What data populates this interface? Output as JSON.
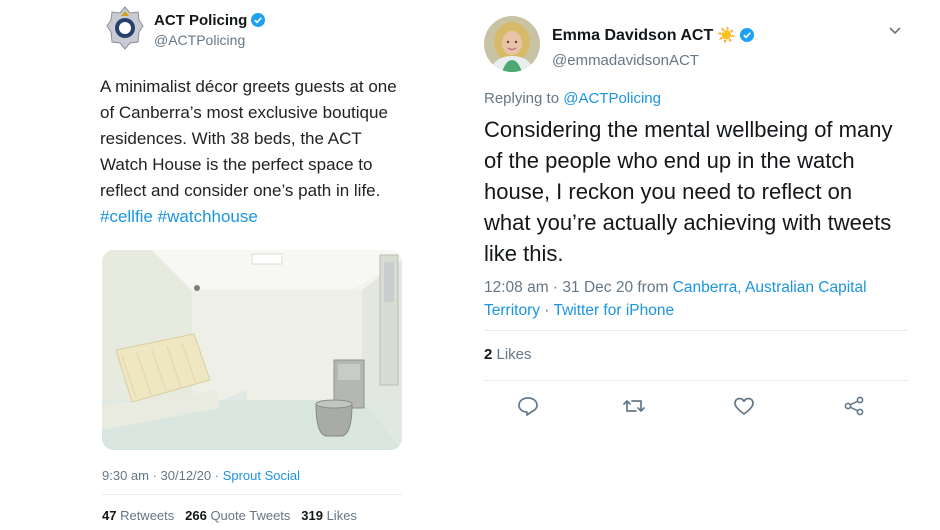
{
  "left_tweet": {
    "author_name": "ACT Policing",
    "author_handle": "@ACTPolicing",
    "text": "A minimalist décor greets guests at one of Canberra’s most exclusive boutique residences. With 38 beds, the ACT Watch House is the perfect space to reflect and consider one’s path in life.",
    "hashtags": [
      "#cellfie",
      "#watchhouse"
    ],
    "time": "9:30 am · 30/12/20 · ",
    "source": "Sprout Social",
    "stats": {
      "retweets_count": "47",
      "retweets_label": " Retweets",
      "quote_count": "266",
      "quote_label": " Quote Tweets",
      "likes_count": "319",
      "likes_label": " Likes"
    }
  },
  "right_tweet": {
    "author_name": "Emma Davidson ACT",
    "author_emoji": "☀️",
    "author_handle": "@emmadavidsonACT",
    "replying_prefix": "Replying to ",
    "replying_to": "@ACTPolicing",
    "text": "Considering the mental wellbeing of many of the people who end up in the watch house, I reckon you need to reflect on what you’re actually achieving with tweets like this.",
    "time": "12:08 am · 31 Dec 20 from ",
    "location": "Canberra, Australian Capital Territory",
    "separator": " · ",
    "source": "Twitter for iPhone",
    "likes_count": "2",
    "likes_label": " Likes"
  },
  "icons": {
    "verified": "verified-badge-icon",
    "reply": "reply-icon",
    "retweet": "retweet-icon",
    "like": "heart-icon",
    "share": "share-icon",
    "more": "chevron-down-icon"
  },
  "colors": {
    "link": "#1b95e0",
    "muted": "#657786",
    "text": "#14171a",
    "verified": "#1da1f2"
  }
}
